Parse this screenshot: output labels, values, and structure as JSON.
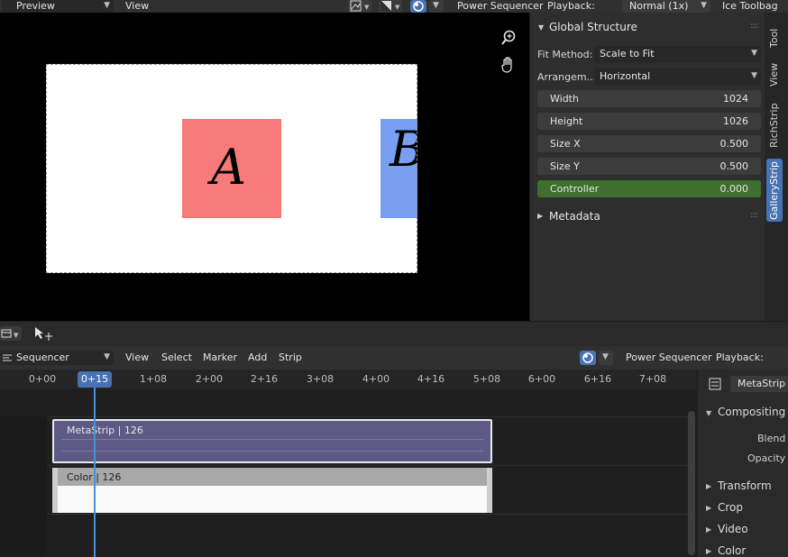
{
  "top_header": {
    "mode_label": "Preview",
    "view_label": "View",
    "power_sequencer_label": "Power Sequencer",
    "playback_label": "Playback:",
    "playback_value": "Normal (1x)",
    "ice_toolbag_label": "Ice Toolbag"
  },
  "preview": {
    "tile_a_letter": "A",
    "tile_b_letter": "B",
    "tile_a_color": "#f67a7a",
    "tile_b_color": "#789ff2"
  },
  "side_panel": {
    "section_title": "Global Structure",
    "fit_method_label": "Fit Method:",
    "fit_method_value": "Scale to Fit",
    "arrangement_label": "Arrangem...",
    "arrangement_value": "Horizontal",
    "fields": [
      {
        "label": "Width",
        "value": "1024"
      },
      {
        "label": "Height",
        "value": "1026"
      },
      {
        "label": "Size X",
        "value": "0.500"
      },
      {
        "label": "Size Y",
        "value": "0.500"
      },
      {
        "label": "Controller",
        "value": "0.000"
      }
    ],
    "metadata_label": "Metadata",
    "tabs": [
      "Tool",
      "View",
      "RichStrip",
      "GalleryStrip"
    ],
    "controller_color": "#3f6f2e",
    "active_tab_color": "#4772b3"
  },
  "sequencer_header": {
    "editor_label": "Sequencer",
    "menu": [
      "View",
      "Select",
      "Marker",
      "Add",
      "Strip"
    ],
    "power_sequencer_label": "Power Sequencer",
    "playback_label": "Playback:"
  },
  "ruler": {
    "current_frame": "0+15",
    "ticks": [
      "0+00",
      "1+08",
      "2+00",
      "2+16",
      "3+08",
      "4+00",
      "4+16",
      "5+08",
      "6+00",
      "6+16",
      "7+08"
    ]
  },
  "strips": {
    "meta_label": "MetaStrip | 126",
    "color_label": "Color | 126",
    "meta_color": "#5e5a86"
  },
  "strip_panel": {
    "active_strip": "MetaStrip",
    "compositing_label": "Compositing",
    "blend_label": "Blend",
    "opacity_label": "Opacity",
    "sections": [
      "Transform",
      "Crop",
      "Video",
      "Color"
    ]
  }
}
